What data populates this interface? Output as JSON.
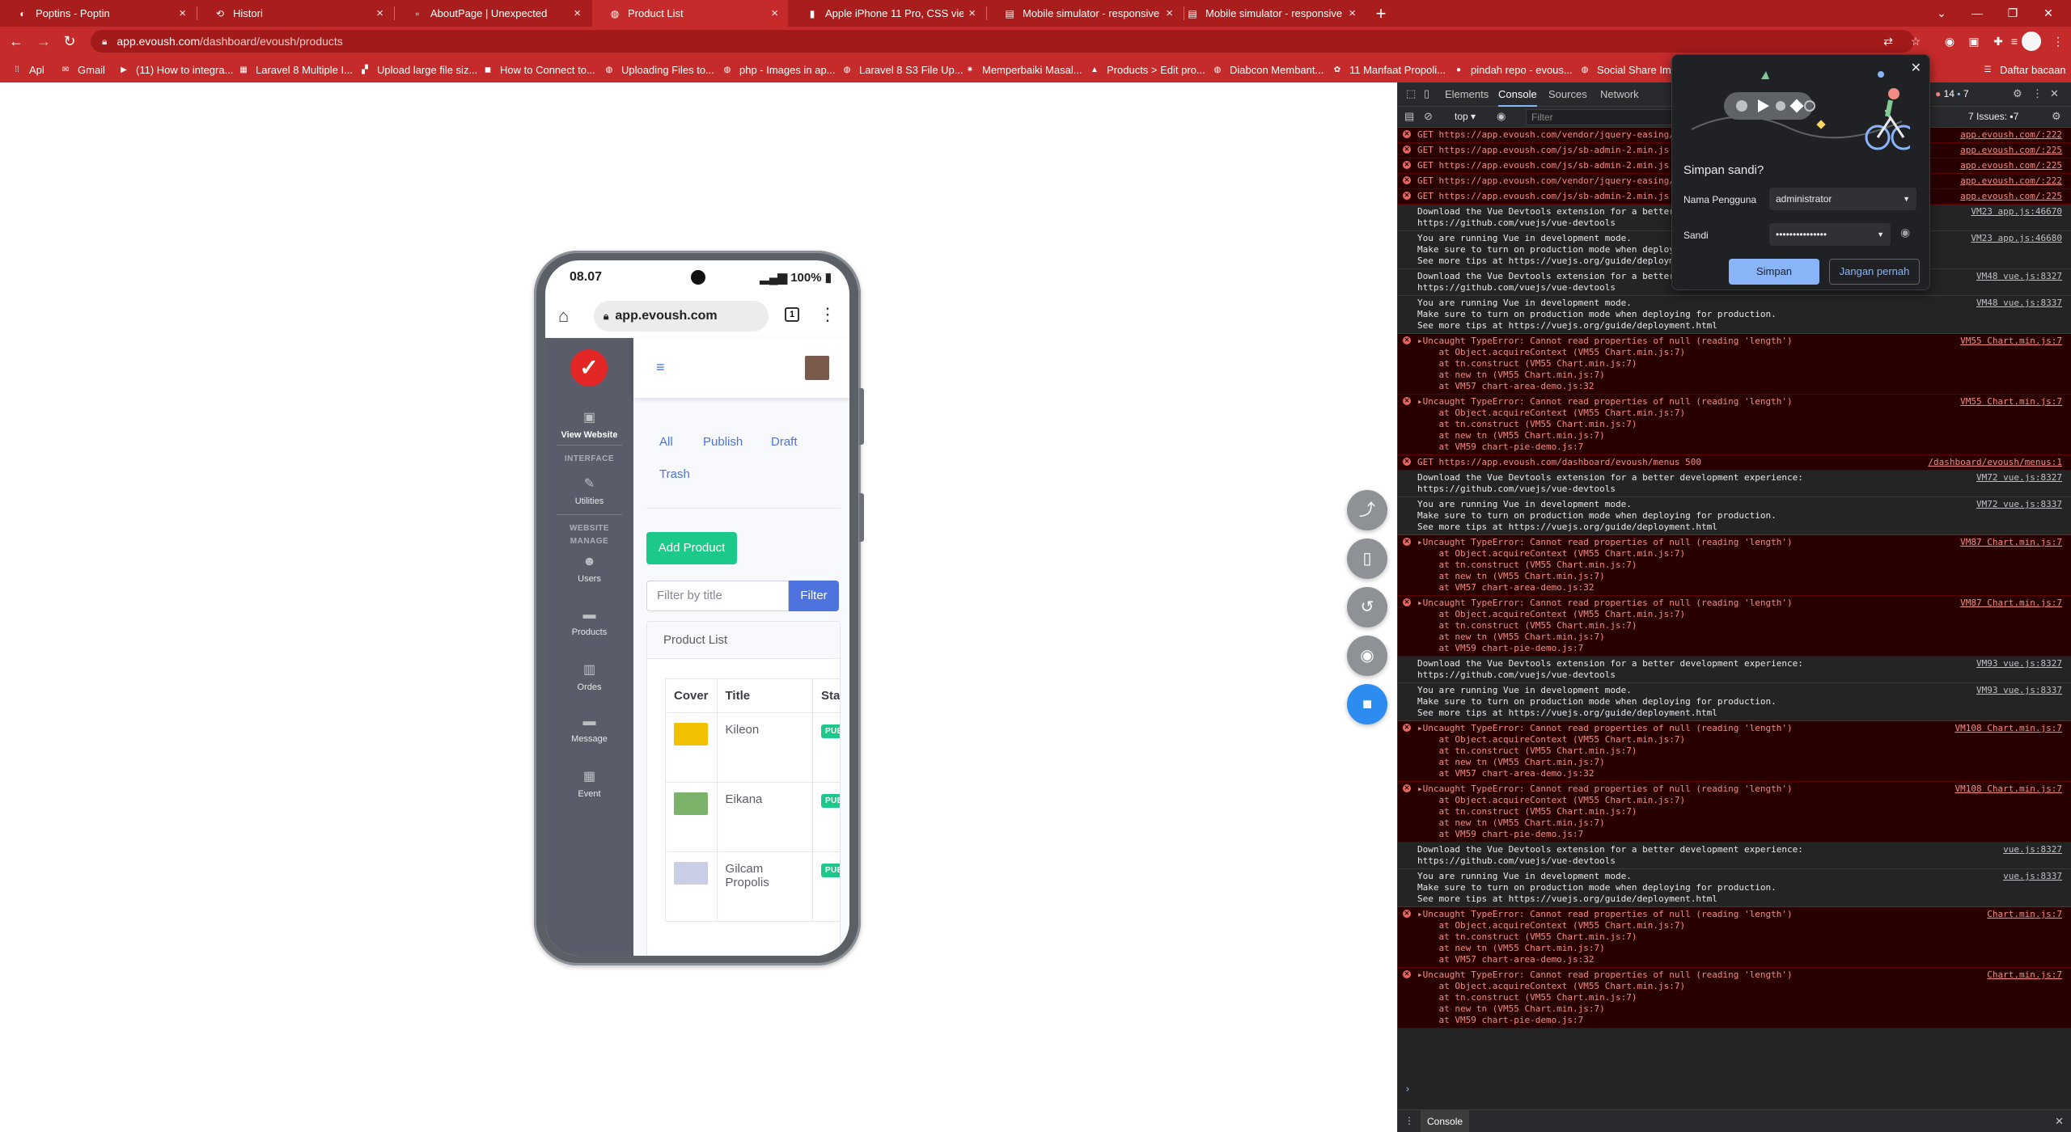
{
  "browser": {
    "tabs": [
      {
        "label": "Poptins - Poptin",
        "icon": "poptin-icon"
      },
      {
        "label": "Histori",
        "icon": "history-icon"
      },
      {
        "label": "AboutPage | Unexpected",
        "icon": "page-icon"
      },
      {
        "label": "Product List",
        "icon": "globe-icon"
      },
      {
        "label": "Apple iPhone 11 Pro, CSS viewpo",
        "icon": "bookmark-icon"
      },
      {
        "label": "Mobile simulator - responsive te",
        "icon": "simulator-icon"
      },
      {
        "label": "Mobile simulator - responsive te",
        "icon": "simulator-icon"
      }
    ],
    "active_tab_index": 3,
    "url_domain": "app.evoush.com",
    "url_path": "/dashboard/evoush/products",
    "bookmarks": [
      "Apl",
      "Gmail",
      "(11) How to integra...",
      "Laravel 8 Multiple I...",
      "Upload large file siz...",
      "How to Connect to...",
      "Uploading Files to...",
      "php - Images in ap...",
      "Laravel 8 S3 File Up...",
      "Memperbaiki Masal...",
      "Products > Edit pro...",
      "Diabcon Membant...",
      "11 Manfaat Propoli...",
      "pindah repo - evous...",
      "Social Share Imag"
    ],
    "reading_list": "Daftar bacaan"
  },
  "phone": {
    "time": "08.07",
    "battery": "100%",
    "url": "app.evoush.com",
    "tab_count": "1"
  },
  "app": {
    "sidebar": {
      "view_website": "View Website",
      "heading_interface": "INTERFACE",
      "utilities": "Utilities",
      "heading_manage": "WEBSITE MANAGE",
      "users": "Users",
      "products": "Products",
      "orders": "Ordes",
      "message": "Message",
      "event": "Event"
    },
    "filter_tabs": [
      "All",
      "Publish",
      "Draft",
      "Trash"
    ],
    "add_product": "Add Product",
    "filter_placeholder": "Filter by title",
    "filter_button": "Filter",
    "card_title": "Product List",
    "table": {
      "headers": [
        "Cover",
        "Title",
        "Status"
      ],
      "rows": [
        {
          "title": "Kileon",
          "status": "PUBLISH",
          "cover_color": "#f2c200"
        },
        {
          "title": "Eikana",
          "status": "PUBLISH",
          "cover_color": "#7bb36a"
        },
        {
          "title": "Gilcam Propolis",
          "status": "PUBLISH",
          "cover_color": "#c9cde6"
        }
      ]
    }
  },
  "devtools": {
    "tabs": [
      "Elements",
      "Console",
      "Sources",
      "Network"
    ],
    "active_tab": "Console",
    "error_count": "14",
    "info_count": "7",
    "context": "top",
    "filter_placeholder": "Filter",
    "issues": "7 Issues:",
    "issues_count": "7",
    "drawer_tab": "Console",
    "messages": [
      {
        "type": "error",
        "lines": [
          "GET https://app.evoush.com/vendor/jquery-easing/"
        ],
        "src": "app.evoush.com/:222"
      },
      {
        "type": "error",
        "lines": [
          "GET https://app.evoush.com/js/sb-admin-2.min.js"
        ],
        "src": "app.evoush.com/:225"
      },
      {
        "type": "error",
        "lines": [
          "GET https://app.evoush.com/js/sb-admin-2.min.js"
        ],
        "src": "app.evoush.com/:225"
      },
      {
        "type": "error",
        "lines": [
          "GET https://app.evoush.com/vendor/jquery-easing/"
        ],
        "src": "app.evoush.com/:222"
      },
      {
        "type": "error",
        "lines": [
          "GET https://app.evoush.com/js/sb-admin-2.min.js"
        ],
        "src": "app.evoush.com/:225"
      },
      {
        "type": "log",
        "lines": [
          "Download the Vue Devtools extension for a better",
          "https://github.com/vuejs/vue-devtools"
        ],
        "src": "VM23 app.js:46670"
      },
      {
        "type": "log",
        "lines": [
          "You are running Vue in development mode.",
          "Make sure to turn on production mode when deploy",
          "See more tips at https://vuejs.org/guide/deploym"
        ],
        "src": "VM23 app.js:46680"
      },
      {
        "type": "log",
        "lines": [
          "Download the Vue Devtools extension for a better",
          "https://github.com/vuejs/vue-devtools"
        ],
        "src": "VM48 vue.js:8327"
      },
      {
        "type": "log",
        "lines": [
          "You are running Vue in development mode.",
          "Make sure to turn on production mode when deploying for production.",
          "See more tips at https://vuejs.org/guide/deployment.html"
        ],
        "src": "VM48 vue.js:8337"
      },
      {
        "type": "error",
        "lines": [
          "▸Uncaught TypeError: Cannot read properties of null (reading 'length')",
          "    at Object.acquireContext (VM55 Chart.min.js:7)",
          "    at tn.construct (VM55 Chart.min.js:7)",
          "    at new tn (VM55 Chart.min.js:7)",
          "    at VM57 chart-area-demo.js:32"
        ],
        "src": "VM55 Chart.min.js:7"
      },
      {
        "type": "error",
        "lines": [
          "▸Uncaught TypeError: Cannot read properties of null (reading 'length')",
          "    at Object.acquireContext (VM55 Chart.min.js:7)",
          "    at tn.construct (VM55 Chart.min.js:7)",
          "    at new tn (VM55 Chart.min.js:7)",
          "    at VM59 chart-pie-demo.js:7"
        ],
        "src": "VM55 Chart.min.js:7"
      },
      {
        "type": "error",
        "lines": [
          "GET https://app.evoush.com/dashboard/evoush/menus 500"
        ],
        "src": "/dashboard/evoush/menus:1"
      },
      {
        "type": "log",
        "lines": [
          "Download the Vue Devtools extension for a better development experience:",
          "https://github.com/vuejs/vue-devtools"
        ],
        "src": "VM72 vue.js:8327"
      },
      {
        "type": "log",
        "lines": [
          "You are running Vue in development mode.",
          "Make sure to turn on production mode when deploying for production.",
          "See more tips at https://vuejs.org/guide/deployment.html"
        ],
        "src": "VM72 vue.js:8337"
      },
      {
        "type": "error",
        "lines": [
          "▸Uncaught TypeError: Cannot read properties of null (reading 'length')",
          "    at Object.acquireContext (VM55 Chart.min.js:7)",
          "    at tn.construct (VM55 Chart.min.js:7)",
          "    at new tn (VM55 Chart.min.js:7)",
          "    at VM57 chart-area-demo.js:32"
        ],
        "src": "VM87 Chart.min.js:7"
      },
      {
        "type": "error",
        "lines": [
          "▸Uncaught TypeError: Cannot read properties of null (reading 'length')",
          "    at Object.acquireContext (VM55 Chart.min.js:7)",
          "    at tn.construct (VM55 Chart.min.js:7)",
          "    at new tn (VM55 Chart.min.js:7)",
          "    at VM59 chart-pie-demo.js:7"
        ],
        "src": "VM87 Chart.min.js:7"
      },
      {
        "type": "log",
        "lines": [
          "Download the Vue Devtools extension for a better development experience:",
          "https://github.com/vuejs/vue-devtools"
        ],
        "src": "VM93 vue.js:8327"
      },
      {
        "type": "log",
        "lines": [
          "You are running Vue in development mode.",
          "Make sure to turn on production mode when deploying for production.",
          "See more tips at https://vuejs.org/guide/deployment.html"
        ],
        "src": "VM93 vue.js:8337"
      },
      {
        "type": "error",
        "lines": [
          "▸Uncaught TypeError: Cannot read properties of null (reading 'length')",
          "    at Object.acquireContext (VM55 Chart.min.js:7)",
          "    at tn.construct (VM55 Chart.min.js:7)",
          "    at new tn (VM55 Chart.min.js:7)",
          "    at VM57 chart-area-demo.js:32"
        ],
        "src": "VM108 Chart.min.js:7"
      },
      {
        "type": "error",
        "lines": [
          "▸Uncaught TypeError: Cannot read properties of null (reading 'length')",
          "    at Object.acquireContext (VM55 Chart.min.js:7)",
          "    at tn.construct (VM55 Chart.min.js:7)",
          "    at new tn (VM55 Chart.min.js:7)",
          "    at VM59 chart-pie-demo.js:7"
        ],
        "src": "VM108 Chart.min.js:7"
      },
      {
        "type": "log",
        "lines": [
          "Download the Vue Devtools extension for a better development experience:",
          "https://github.com/vuejs/vue-devtools"
        ],
        "src": "vue.js:8327"
      },
      {
        "type": "log",
        "lines": [
          "You are running Vue in development mode.",
          "Make sure to turn on production mode when deploying for production.",
          "See more tips at https://vuejs.org/guide/deployment.html"
        ],
        "src": "vue.js:8337"
      },
      {
        "type": "error",
        "lines": [
          "▸Uncaught TypeError: Cannot read properties of null (reading 'length')",
          "    at Object.acquireContext (VM55 Chart.min.js:7)",
          "    at tn.construct (VM55 Chart.min.js:7)",
          "    at new tn (VM55 Chart.min.js:7)",
          "    at VM57 chart-area-demo.js:32"
        ],
        "src": "Chart.min.js:7"
      },
      {
        "type": "error",
        "lines": [
          "▸Uncaught TypeError: Cannot read properties of null (reading 'length')",
          "    at Object.acquireContext (VM55 Chart.min.js:7)",
          "    at tn.construct (VM55 Chart.min.js:7)",
          "    at new tn (VM55 Chart.min.js:7)",
          "    at VM59 chart-pie-demo.js:7"
        ],
        "src": "Chart.min.js:7"
      }
    ]
  },
  "password_popup": {
    "title": "Simpan sandi?",
    "username_label": "Nama Pengguna",
    "username_value": "administrator",
    "password_label": "Sandi",
    "password_value": "•••••••••••••••",
    "save_button": "Simpan",
    "never_button": "Jangan pernah"
  }
}
